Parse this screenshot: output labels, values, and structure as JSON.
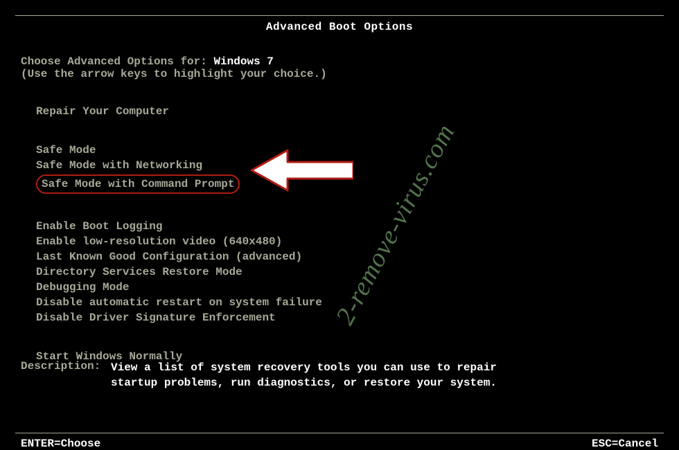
{
  "title": "Advanced Boot Options",
  "intro_prefix": "Choose Advanced Options for: ",
  "os_name": "Windows 7",
  "intro_help": "(Use the arrow keys to highlight your choice.)",
  "groups": [
    {
      "items": [
        "Repair Your Computer"
      ]
    },
    {
      "items": [
        "Safe Mode",
        "Safe Mode with Networking",
        "Safe Mode with Command Prompt"
      ],
      "highlighted_index": 2
    },
    {
      "items": [
        "Enable Boot Logging",
        "Enable low-resolution video (640x480)",
        "Last Known Good Configuration (advanced)",
        "Directory Services Restore Mode",
        "Debugging Mode",
        "Disable automatic restart on system failure",
        "Disable Driver Signature Enforcement"
      ]
    },
    {
      "items": [
        "Start Windows Normally"
      ]
    }
  ],
  "description_label": "Description:",
  "description_text": "View a list of system recovery tools you can use to repair startup problems, run diagnostics, or restore your system.",
  "footer_left": "ENTER=Choose",
  "footer_right": "ESC=Cancel",
  "watermark": "2-remove-virus.com",
  "annotation": {
    "highlight_color": "#b01d13"
  }
}
